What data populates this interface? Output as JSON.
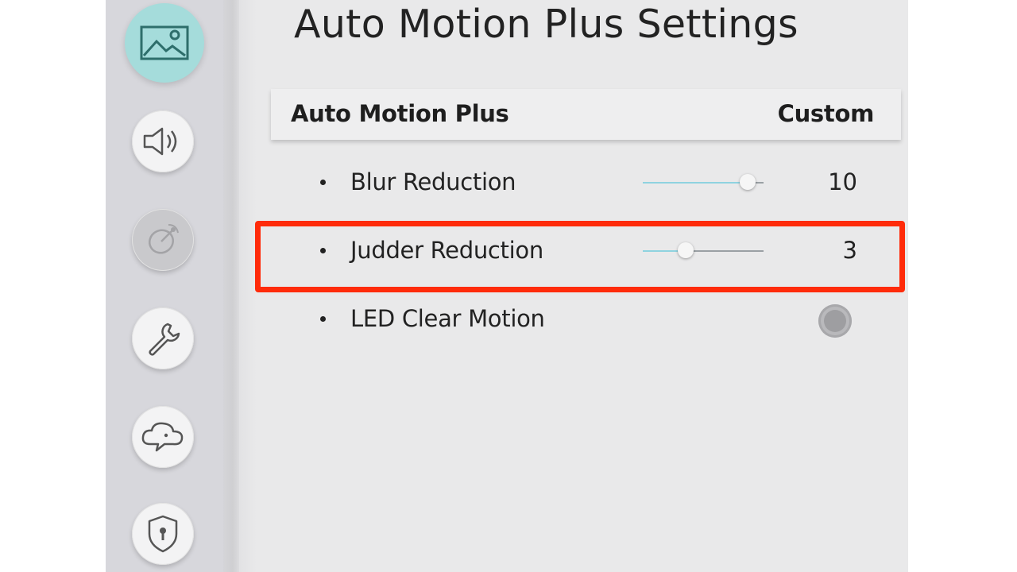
{
  "page": {
    "title": "Auto Motion Plus Settings"
  },
  "sidebar": {
    "items": [
      {
        "icon": "picture-icon",
        "active": true
      },
      {
        "icon": "speaker-icon",
        "active": false
      },
      {
        "icon": "broadcast-icon",
        "active": false,
        "disabled": true
      },
      {
        "icon": "wrench-icon",
        "active": false
      },
      {
        "icon": "support-chat-icon",
        "active": false
      },
      {
        "icon": "shield-lock-icon",
        "active": false
      }
    ]
  },
  "header": {
    "label": "Auto Motion Plus",
    "value": "Custom"
  },
  "rows": [
    {
      "label": "Blur Reduction",
      "value": "10",
      "level": 1.0
    },
    {
      "label": "Judder Reduction",
      "value": "3",
      "level": 0.3
    },
    {
      "label": "LED Clear Motion",
      "toggle": "off"
    }
  ],
  "colors": {
    "accent": "#a5dcdb",
    "highlight": "#ff2b0a",
    "slider_fill": "#8fd3e0"
  }
}
